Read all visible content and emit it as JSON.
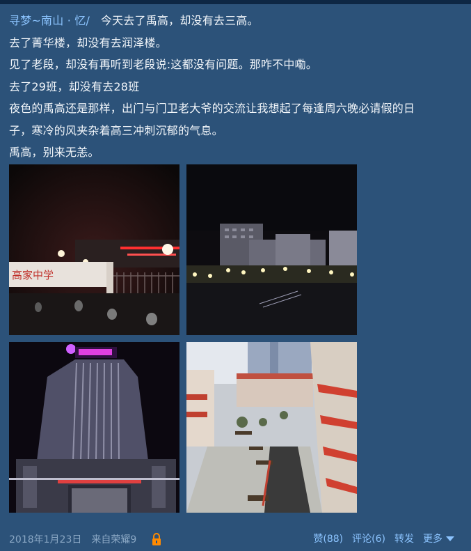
{
  "post": {
    "author": "寻梦~南山 · 忆",
    "separator": "/",
    "lines": [
      "今天去了禹高，却没有去三高。",
      "去了菁华楼，却没有去润泽楼。",
      "见了老段，却没有再听到老段说:这都没有问题。那咋不中嘞。",
      "去了29班，却没有去28班",
      "夜色的禹高还是那样，出门与门卫老大爷的交流让我想起了每逢周六晚必请假的日",
      "子，寒冷的风夹杂着高三冲刺沉郁的气息。",
      "禹高，别来无恙。"
    ],
    "photos": {
      "p1_sign": "高家中学"
    }
  },
  "footer": {
    "date": "2018年1月23日",
    "source": "来自荣耀9",
    "lock_icon": "lock-icon",
    "like_label": "赞(88)",
    "comment_label": "评论(6)",
    "share_label": "转发",
    "more_label": "更多"
  },
  "colors": {
    "background": "#2c5279",
    "link": "#8cc4ff",
    "text": "#f2f6fa",
    "meta": "#8aa7c4",
    "lock": "#ff8a00"
  }
}
